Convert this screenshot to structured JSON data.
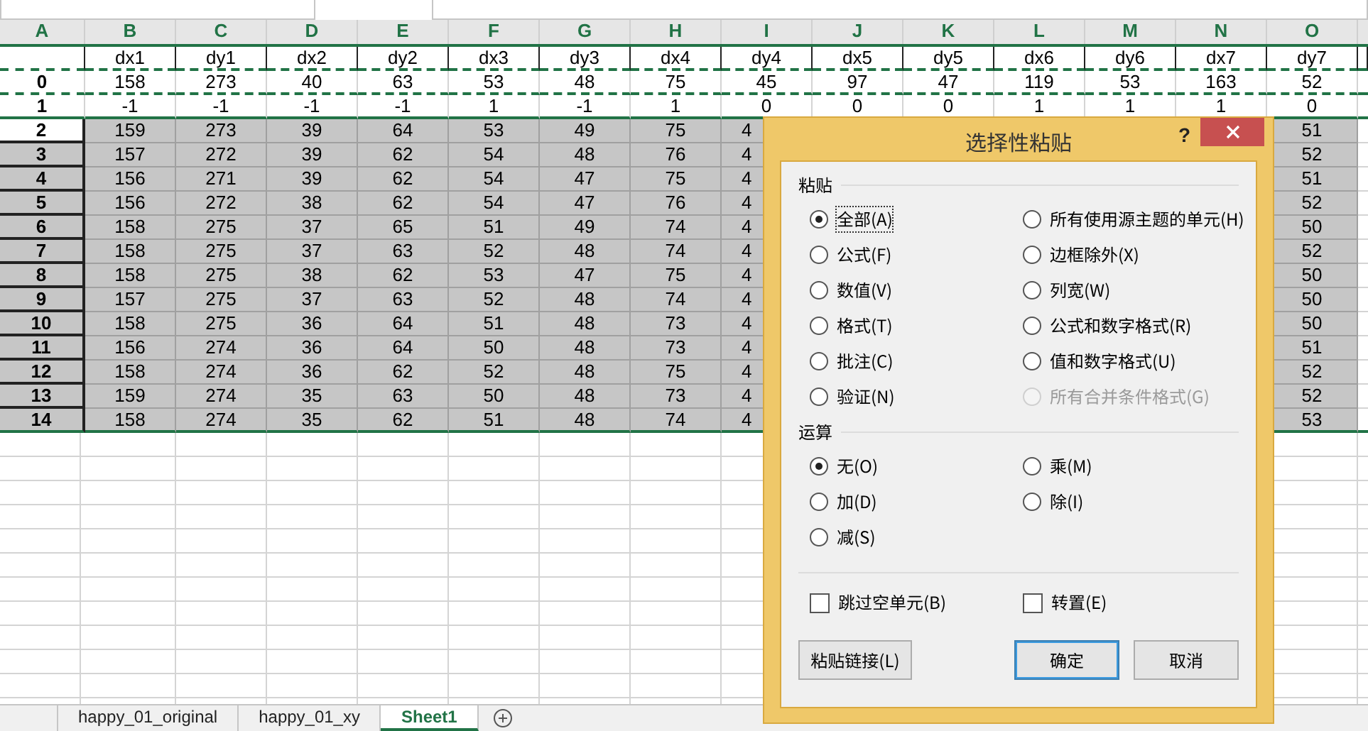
{
  "columns": [
    "A",
    "B",
    "C",
    "D",
    "E",
    "F",
    "G",
    "H",
    "I",
    "J",
    "K",
    "L",
    "M",
    "N",
    "O"
  ],
  "rows": [
    {
      "kind": "header",
      "cells": [
        null,
        "dx1",
        "dy1",
        "dx2",
        "dy2",
        "dx3",
        "dy3",
        "dx4",
        "dy4",
        "dx5",
        "dy5",
        "dx6",
        "dy6",
        "dx7",
        "dy7"
      ]
    },
    {
      "kind": "copied",
      "cells": [
        "0",
        "158",
        "273",
        "40",
        "63",
        "53",
        "48",
        "75",
        "45",
        "97",
        "47",
        "119",
        "53",
        "163",
        "52"
      ]
    },
    {
      "kind": "plain",
      "cells": [
        "1",
        "-1",
        "-1",
        "-1",
        "-1",
        "1",
        "-1",
        "1",
        "0",
        "0",
        "0",
        "1",
        "1",
        "1",
        "0"
      ]
    },
    {
      "kind": "selected",
      "active": true,
      "cells": [
        "2",
        "159",
        "273",
        "39",
        "64",
        "53",
        "49",
        "75",
        "4",
        null,
        null,
        null,
        null,
        null,
        "51"
      ]
    },
    {
      "kind": "selected",
      "active": false,
      "cells": [
        "3",
        "157",
        "272",
        "39",
        "62",
        "54",
        "48",
        "76",
        "4",
        null,
        null,
        null,
        null,
        null,
        "52"
      ]
    },
    {
      "kind": "selected",
      "active": false,
      "cells": [
        "4",
        "156",
        "271",
        "39",
        "62",
        "54",
        "47",
        "75",
        "4",
        null,
        null,
        null,
        null,
        null,
        "51"
      ]
    },
    {
      "kind": "selected",
      "active": false,
      "cells": [
        "5",
        "156",
        "272",
        "38",
        "62",
        "54",
        "47",
        "76",
        "4",
        null,
        null,
        null,
        null,
        null,
        "52"
      ]
    },
    {
      "kind": "selected",
      "active": false,
      "cells": [
        "6",
        "158",
        "275",
        "37",
        "65",
        "51",
        "49",
        "74",
        "4",
        null,
        null,
        null,
        null,
        null,
        "50"
      ]
    },
    {
      "kind": "selected",
      "active": false,
      "cells": [
        "7",
        "158",
        "275",
        "37",
        "63",
        "52",
        "48",
        "74",
        "4",
        null,
        null,
        null,
        null,
        null,
        "52"
      ]
    },
    {
      "kind": "selected",
      "active": false,
      "cells": [
        "8",
        "158",
        "275",
        "38",
        "62",
        "53",
        "47",
        "75",
        "4",
        null,
        null,
        null,
        null,
        null,
        "50"
      ]
    },
    {
      "kind": "selected",
      "active": false,
      "cells": [
        "9",
        "157",
        "275",
        "37",
        "63",
        "52",
        "48",
        "74",
        "4",
        null,
        null,
        null,
        null,
        null,
        "50"
      ]
    },
    {
      "kind": "selected",
      "active": false,
      "cells": [
        "10",
        "158",
        "275",
        "36",
        "64",
        "51",
        "48",
        "73",
        "4",
        null,
        null,
        null,
        null,
        null,
        "50"
      ]
    },
    {
      "kind": "selected",
      "active": false,
      "cells": [
        "11",
        "156",
        "274",
        "36",
        "64",
        "50",
        "48",
        "73",
        "4",
        null,
        null,
        null,
        null,
        null,
        "51"
      ]
    },
    {
      "kind": "selected",
      "active": false,
      "cells": [
        "12",
        "158",
        "274",
        "36",
        "62",
        "52",
        "48",
        "75",
        "4",
        null,
        null,
        null,
        null,
        null,
        "52"
      ]
    },
    {
      "kind": "selected",
      "active": false,
      "cells": [
        "13",
        "159",
        "274",
        "35",
        "63",
        "50",
        "48",
        "73",
        "4",
        null,
        null,
        null,
        null,
        null,
        "52"
      ]
    },
    {
      "kind": "selected",
      "active": false,
      "cells": [
        "14",
        "158",
        "274",
        "35",
        "62",
        "51",
        "48",
        "74",
        "4",
        null,
        null,
        null,
        null,
        null,
        "53"
      ]
    }
  ],
  "sheet_tabs": [
    {
      "label": "happy_01_original",
      "selected": false
    },
    {
      "label": "happy_01_xy",
      "selected": false
    },
    {
      "label": "Sheet1",
      "selected": true
    }
  ],
  "dialog": {
    "title": "选择性粘贴",
    "help": "?",
    "paste_section": "粘贴",
    "paste_options": [
      {
        "label": "全部(A)",
        "selected": true,
        "disabled": false
      },
      {
        "label": "所有使用源主题的单元(H)",
        "selected": false,
        "disabled": false
      },
      {
        "label": "公式(F)",
        "selected": false,
        "disabled": false
      },
      {
        "label": "边框除外(X)",
        "selected": false,
        "disabled": false
      },
      {
        "label": "数值(V)",
        "selected": false,
        "disabled": false
      },
      {
        "label": "列宽(W)",
        "selected": false,
        "disabled": false
      },
      {
        "label": "格式(T)",
        "selected": false,
        "disabled": false
      },
      {
        "label": "公式和数字格式(R)",
        "selected": false,
        "disabled": false
      },
      {
        "label": "批注(C)",
        "selected": false,
        "disabled": false
      },
      {
        "label": "值和数字格式(U)",
        "selected": false,
        "disabled": false
      },
      {
        "label": "验证(N)",
        "selected": false,
        "disabled": false
      },
      {
        "label": "所有合并条件格式(G)",
        "selected": false,
        "disabled": true
      }
    ],
    "operation_section": "运算",
    "operation_options": [
      {
        "label": "无(O)",
        "selected": true
      },
      {
        "label": "乘(M)",
        "selected": false
      },
      {
        "label": "加(D)",
        "selected": false
      },
      {
        "label": "除(I)",
        "selected": false
      },
      {
        "label": "减(S)",
        "selected": false
      }
    ],
    "checkboxes": [
      {
        "label": "跳过空单元(B)",
        "checked": false
      },
      {
        "label": "转置(E)",
        "checked": false
      }
    ],
    "buttons": [
      {
        "label": "粘贴链接(L)",
        "kind": "secondary"
      },
      {
        "label": "确定",
        "kind": "default"
      },
      {
        "label": "取消",
        "kind": "secondary"
      }
    ]
  }
}
